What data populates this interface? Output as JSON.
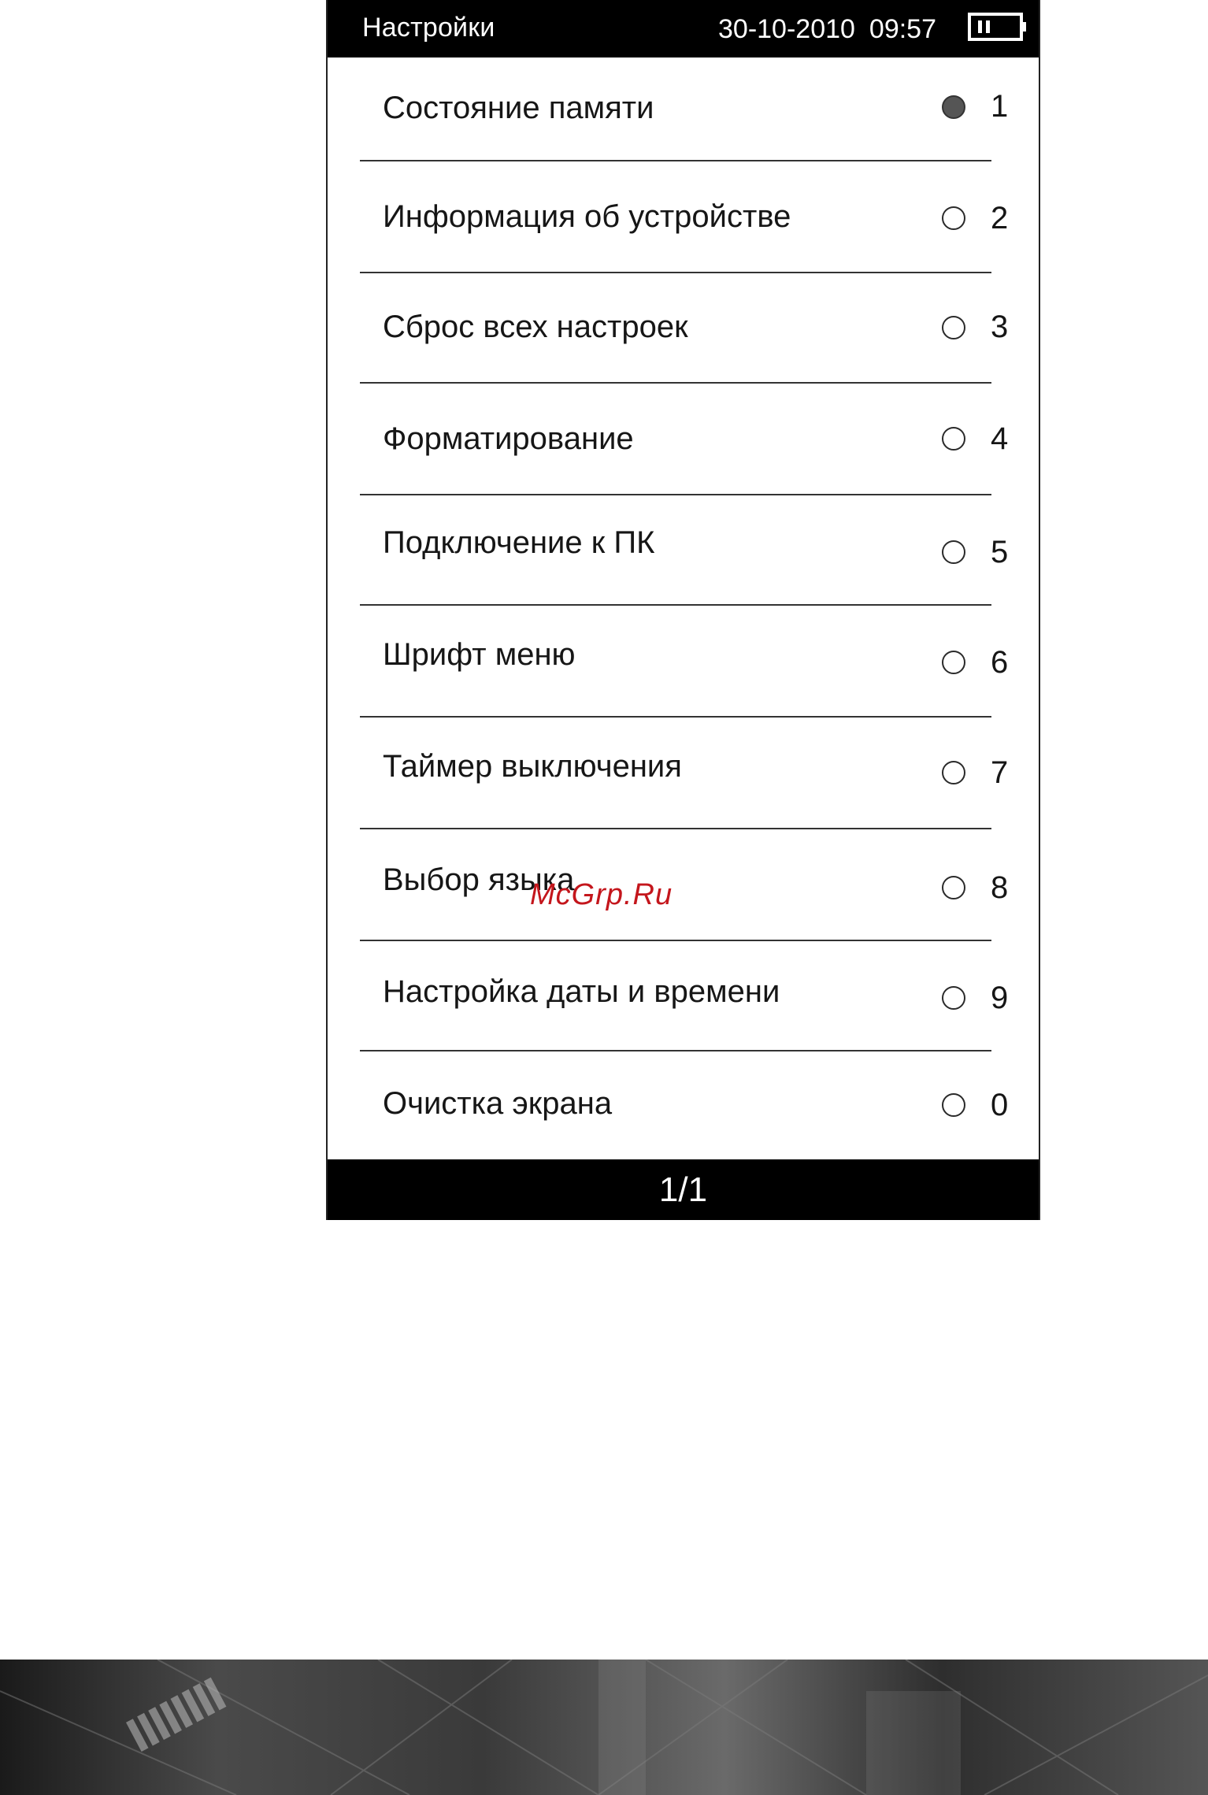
{
  "header": {
    "title": "Настройки",
    "date": "30-10-2010",
    "time": "09:57",
    "battery_icon": "battery-icon"
  },
  "menu": {
    "items": [
      {
        "label": "Состояние памяти",
        "number": "1",
        "selected": true
      },
      {
        "label": "Информация об устройстве",
        "number": "2",
        "selected": false
      },
      {
        "label": "Сброс всех настроек",
        "number": "3",
        "selected": false
      },
      {
        "label": "Форматирование",
        "number": "4",
        "selected": false
      },
      {
        "label": "Подключение к ПК",
        "number": "5",
        "selected": false
      },
      {
        "label": "Шрифт меню",
        "number": "6",
        "selected": false
      },
      {
        "label": "Таймер выключения",
        "number": "7",
        "selected": false
      },
      {
        "label": "Выбор языка",
        "number": "8",
        "selected": false
      },
      {
        "label": "Настройка даты и времени",
        "number": "9",
        "selected": false
      },
      {
        "label": "Очистка экрана",
        "number": "0",
        "selected": false
      }
    ]
  },
  "footer": {
    "page": "1/1"
  },
  "watermark": {
    "text": "McGrp.Ru"
  },
  "colors": {
    "bar_background": "#000000",
    "bar_text": "#ffffff",
    "selected_radio": "#555555",
    "watermark": "#c4161c"
  }
}
